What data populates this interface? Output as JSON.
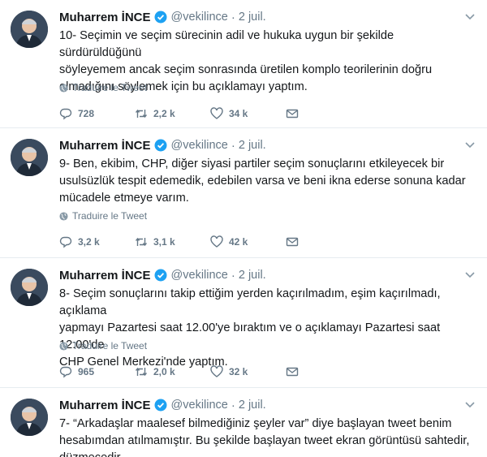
{
  "tweets": [
    {
      "name": "Muharrem İNCE",
      "handle": "@vekilince",
      "separator": "·",
      "time": "2 juil.",
      "text": "10- Seçimin ve seçim sürecinin adil ve hukuka uygun bir şekilde sürdürüldüğünü\nsöyleyemem ancak seçim sonrasında üretilen komplo teorilerinin doğru\nolmadığını söylemek için bu açıklamayı yaptım.",
      "translate": "Traduire le Tweet",
      "replies": "728",
      "retweets": "2,2 k",
      "likes": "34 k"
    },
    {
      "name": "Muharrem İNCE",
      "handle": "@vekilince",
      "separator": "·",
      "time": "2 juil.",
      "text": "9- Ben, ekibim, CHP, diğer siyasi partiler seçim sonuçlarını etkileyecek bir\nusulsüzlük tespit edemedik, edebilen varsa ve beni ikna ederse sonuna kadar\nmücadele etmeye varım.",
      "translate": "Traduire le Tweet",
      "replies": "3,2 k",
      "retweets": "3,1 k",
      "likes": "42 k"
    },
    {
      "name": "Muharrem İNCE",
      "handle": "@vekilince",
      "separator": "·",
      "time": "2 juil.",
      "text": "8- Seçim sonuçlarını takip ettiğim yerden kaçırılmadım, eşim kaçırılmadı, açıklama\nyapmayı Pazartesi saat 12.00'ye bıraktım ve o açıklamayı Pazartesi saat 12:00'de\nCHP Genel Merkezi'nde yaptım.",
      "translate": "Traduire le Tweet",
      "replies": "965",
      "retweets": "2,0 k",
      "likes": "32 k"
    },
    {
      "name": "Muharrem İNCE",
      "handle": "@vekilince",
      "separator": "·",
      "time": "2 juil.",
      "text": "7- “Arkadaşlar maalesef bilmediğiniz şeyler var” diye başlayan tweet benim\nhesabımdan atılmamıştır. Bu şekilde başlayan tweet ekran görüntüsü sahtedir,\ndüzmecedir."
    }
  ],
  "colors": {
    "text": "#14171a",
    "muted": "#657786",
    "verified": "#1da1f2",
    "divider": "#e6ecf0"
  },
  "icons": [
    "verified-badge-icon",
    "chevron-down-icon",
    "globe-icon",
    "reply-icon",
    "retweet-icon",
    "like-icon",
    "direct-message-icon"
  ]
}
